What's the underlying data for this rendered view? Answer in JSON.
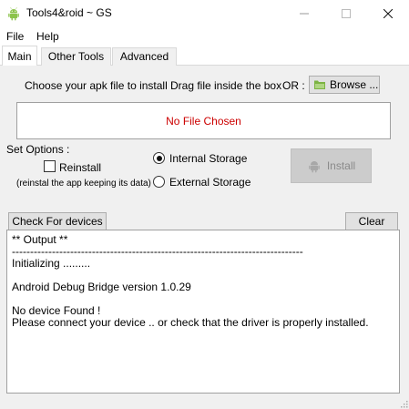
{
  "window": {
    "title": "Tools4&roid ~ GS",
    "icon": "android-icon",
    "minimize_glyph": "—",
    "maximize_glyph": "☐",
    "close_glyph": "✕"
  },
  "menu": {
    "file": "File",
    "help": "Help"
  },
  "tabs": [
    {
      "label": "Main",
      "active": true
    },
    {
      "label": "Other Tools",
      "active": false
    },
    {
      "label": "Advanced",
      "active": false
    }
  ],
  "main": {
    "choose_label": "Choose your apk file to install :",
    "drag_label": "Drag file inside the box",
    "or_label": "OR :",
    "browse_label": "Browse ...",
    "drop_status": "No File Chosen",
    "set_options_label": "Set Options :",
    "reinstall_label": "Reinstall",
    "reinstall_checked": false,
    "reinstall_hint": "(reinstal the app keeping its data)",
    "internal_label": "Internal Storage",
    "external_label": "External Storage",
    "storage_selected": "internal",
    "install_label": "Install",
    "check_devices_label": "Check For devices",
    "clear_label": "Clear"
  },
  "output": {
    "header": "** Output **",
    "separator": "--------------------------------------------------------------------------------",
    "initializing": "Initializing .........",
    "adb_version": "Android Debug Bridge version 1.0.29",
    "no_device": "No device Found !",
    "connect_hint": "Please connect your device .. or check that the driver is properly installed."
  },
  "colors": {
    "status_red": "#cc0000",
    "panel_bg": "#f0f0f0",
    "android_green": "#8bc34a"
  }
}
